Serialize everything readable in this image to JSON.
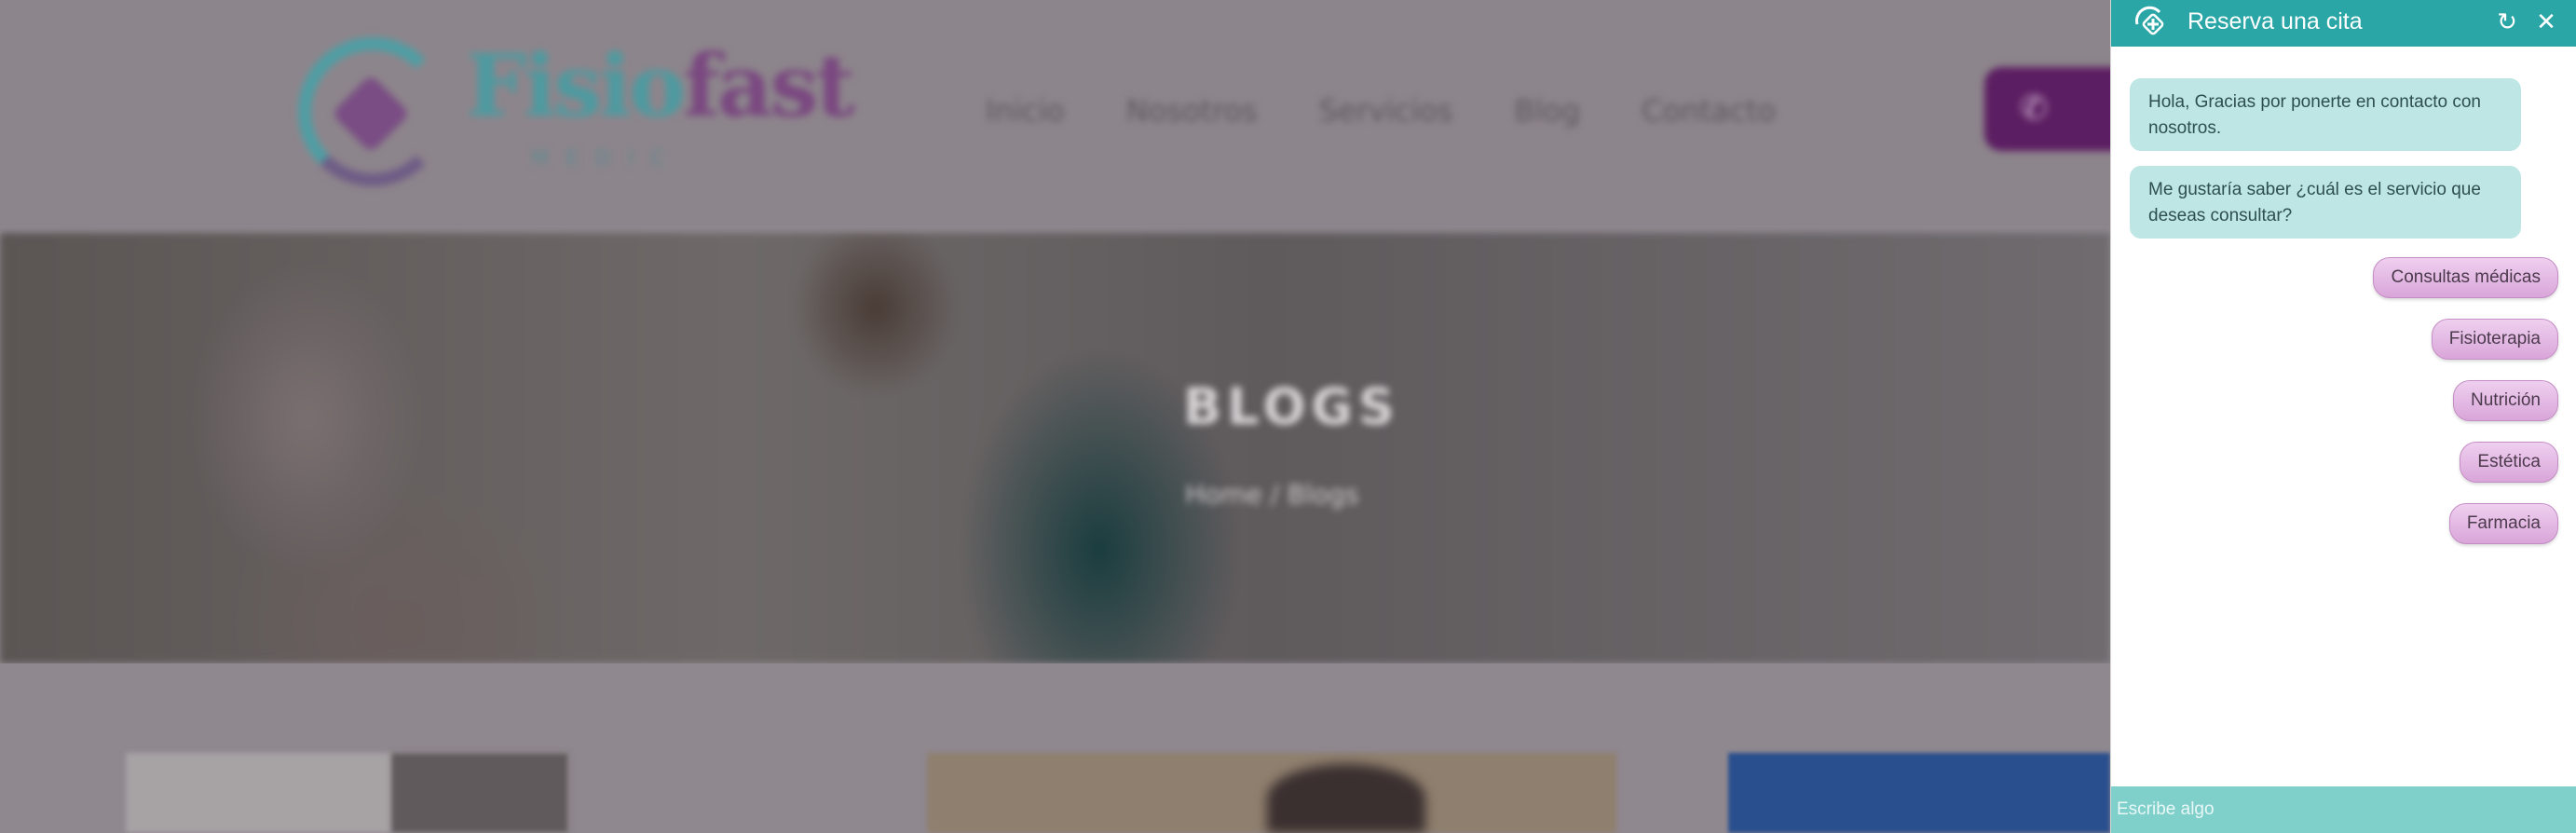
{
  "site": {
    "logo": {
      "name_part1": "Fisio",
      "name_part2": "fast",
      "subtitle": "MEDIC"
    },
    "nav": [
      "Inicio",
      "Nosotros",
      "Servicios",
      "Blog",
      "Contacto"
    ],
    "phone_icon": "phone-icon",
    "hero": {
      "title": "BLOGS",
      "breadcrumb": "Home / Blogs"
    }
  },
  "chat": {
    "title": "Reserva una cita",
    "brand_icon": "medical-cross-icon",
    "refresh_icon": "refresh-icon",
    "close_icon": "close-icon",
    "messages": [
      "Hola, Gracias por ponerte en contacto con nosotros.",
      "Me gustaría saber ¿cuál es el servicio que deseas consultar?"
    ],
    "options": [
      "Consultas médicas",
      "Fisioterapia",
      "Nutrición",
      "Estética",
      "Farmacia"
    ],
    "input_placeholder": "Escribe algo",
    "colors": {
      "header": "#2aa6a6",
      "bubble": "#bde6e4",
      "option": "#d9a6d9",
      "composer": "#7fcfcb"
    }
  }
}
